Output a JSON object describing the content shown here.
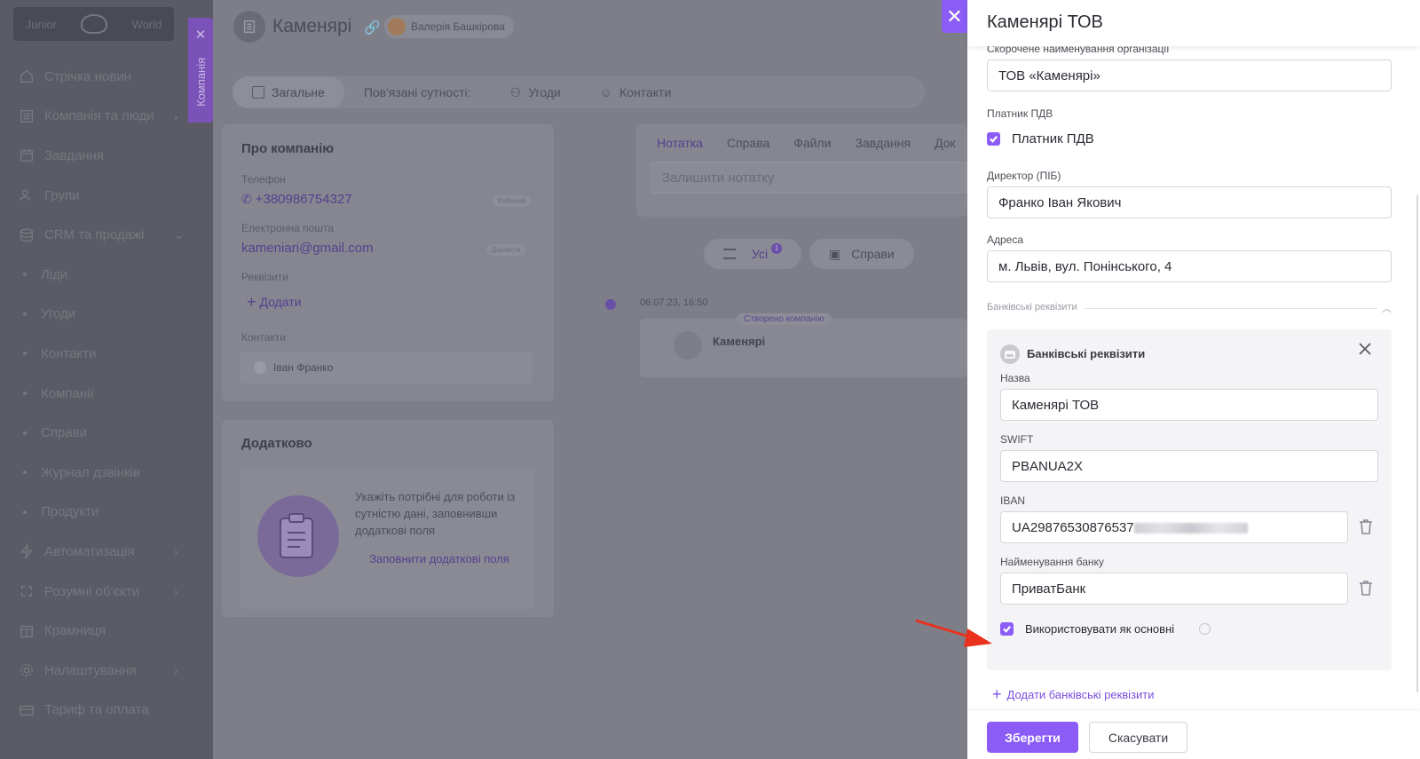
{
  "sidebar": {
    "logo_left": "Junior",
    "logo_right": "World",
    "items": [
      {
        "label": "Стрічка новин",
        "icon": "home-icon",
        "chevron": ""
      },
      {
        "label": "Компанія та люди",
        "icon": "building-icon",
        "chevron": "›"
      },
      {
        "label": "Завдання",
        "icon": "calendar-icon",
        "chevron": ""
      },
      {
        "label": "Групи",
        "icon": "group-icon",
        "chevron": ""
      },
      {
        "label": "CRM та продажі",
        "icon": "database-icon",
        "chevron": "⌄"
      },
      {
        "label": "Ліди",
        "sub": true
      },
      {
        "label": "Угоди",
        "sub": true
      },
      {
        "label": "Контакти",
        "sub": true
      },
      {
        "label": "Компанії",
        "sub": true
      },
      {
        "label": "Справи",
        "sub": true
      },
      {
        "label": "Журнал дзвінків",
        "sub": true
      },
      {
        "label": "Продукти",
        "sub": true
      },
      {
        "label": "Автоматизація",
        "icon": "bolt-icon",
        "chevron": "›"
      },
      {
        "label": "Розумні об'єкти",
        "icon": "smart-icon",
        "chevron": "›"
      },
      {
        "label": "Крамниця",
        "icon": "store-icon",
        "chevron": ""
      },
      {
        "label": "Налаштування",
        "icon": "gear-icon",
        "chevron": "›"
      },
      {
        "label": "Тариф та оплата",
        "icon": "card-icon",
        "chevron": ""
      }
    ]
  },
  "company_tab": {
    "label": "Компанія",
    "close": "✕"
  },
  "header": {
    "title": "Каменярі",
    "user": "Валерія Башкірова"
  },
  "tabs": {
    "general": "Загальне",
    "related": "Пов'язані сутності:",
    "deals": "Угоди",
    "contacts": "Контакти"
  },
  "about": {
    "title": "Про компанію",
    "phone_label": "Телефон",
    "phone": "+380986754327",
    "phone_type": "Робочий",
    "email_label": "Електронна пошта",
    "email": "kameniari@gmail.com",
    "email_type": "Діалекта",
    "requisites_label": "Реквізити",
    "add": "Додати",
    "contacts_label": "Контакти",
    "contact_name": "Іван Франко"
  },
  "extra": {
    "title": "Додатково",
    "text": "Укажіть потрібні для роботи із сутністю дані, заповнивши додаткові поля",
    "link": "Заповнити додаткові поля"
  },
  "notes": {
    "tabs": [
      "Нотатка",
      "Справа",
      "Файли",
      "Завдання",
      "Док"
    ],
    "placeholder": "Залишити нотатку"
  },
  "filters": {
    "all": "Усі",
    "all_count": "1",
    "cases": "Справи"
  },
  "timeline": {
    "date": "06.07.23, 16:50",
    "badge": "Створено компанію",
    "item": "Каменярі"
  },
  "panel": {
    "title": "Каменярі ТОВ",
    "short_name_label": "Скорочене найменування організації",
    "short_name": "ТОВ «Каменярі»",
    "vat_label": "Платник ПДВ",
    "vat_checkbox": "Платник ПДВ",
    "vat_checked": true,
    "director_label": "Директор (ПІБ)",
    "director": "Франко Іван Якович",
    "address_label": "Адреса",
    "address": "м. Львів, вул. Понінського, 4",
    "bank_section": "Банківські реквізити",
    "bank": {
      "title": "Банківські реквізити",
      "name_label": "Назва",
      "name": "Каменярі ТОВ",
      "swift_label": "SWIFT",
      "swift": "PBANUA2X",
      "iban_label": "IBAN",
      "iban": "UA29876530876537",
      "bank_name_label": "Найменування банку",
      "bank_name": "ПриватБанк",
      "use_as_main": "Використовувати як основні",
      "use_as_main_checked": true
    },
    "add_bank": "Додати банківські реквізити",
    "save": "Зберегти",
    "cancel": "Скасувати"
  },
  "colors": {
    "accent": "#8b5cf6",
    "arrow": "#e8321e"
  }
}
